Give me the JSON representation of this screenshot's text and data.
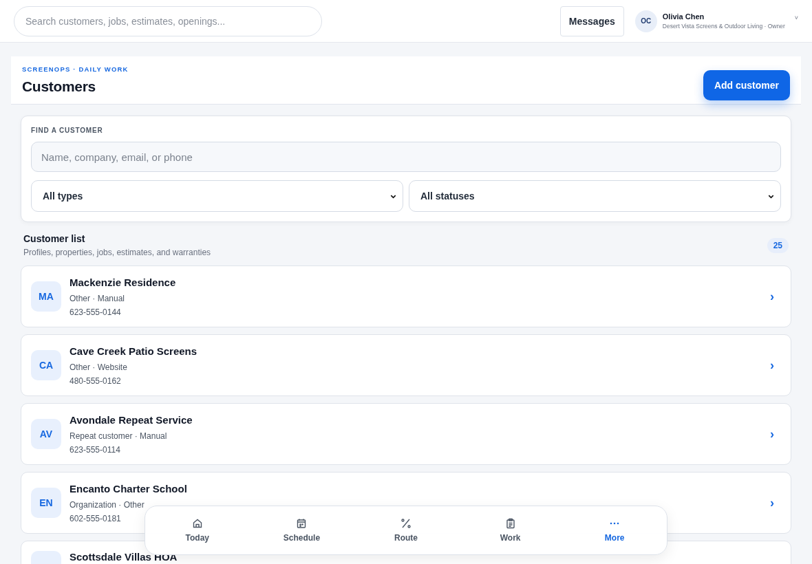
{
  "topbar": {
    "search": {
      "placeholder": "Search customers, jobs, estimates, openings..."
    },
    "messages_button": "Messages",
    "user": {
      "initials": "OC",
      "name": "Olivia Chen",
      "subtitle": "Desert Vista Screens & Outdoor Living · Owner",
      "caret": "˅"
    }
  },
  "page_header": {
    "eyebrow": "SCREENOPS · DAILY WORK",
    "title": "Customers",
    "add_button": "Add customer"
  },
  "filters": {
    "label": "FIND A CUSTOMER",
    "search": {
      "placeholder": "Name, company, email, or phone"
    },
    "type_select": "All types",
    "status_select": "All statuses"
  },
  "list": {
    "title": "Customer list",
    "subtitle": "Profiles, properties, jobs, estimates, and warranties",
    "count": "25",
    "customers": [
      {
        "initials": "MA",
        "name": "Mackenzie Residence",
        "meta": "Other · Manual",
        "phone": "623-555-0144",
        "chevron": "›"
      },
      {
        "initials": "CA",
        "name": "Cave Creek Patio Screens",
        "meta": "Other · Website",
        "phone": "480-555-0162",
        "chevron": "›"
      },
      {
        "initials": "AV",
        "name": "Avondale Repeat Service",
        "meta": "Repeat customer · Manual",
        "phone": "623-555-0114",
        "chevron": "›"
      },
      {
        "initials": "EN",
        "name": "Encanto Charter School",
        "meta": "Organization · Other",
        "phone": "602-555-0181",
        "chevron": "›"
      },
      {
        "name": "Scottsdale Villas HOA"
      }
    ]
  },
  "bottom_nav": [
    {
      "label": "Today",
      "kind": "home",
      "selected": false
    },
    {
      "label": "Schedule",
      "kind": "calendar",
      "selected": false
    },
    {
      "label": "Route",
      "kind": "route",
      "selected": false
    },
    {
      "label": "Work",
      "kind": "clipboard",
      "selected": false
    },
    {
      "label": "More",
      "kind": "more",
      "selected": true
    }
  ]
}
